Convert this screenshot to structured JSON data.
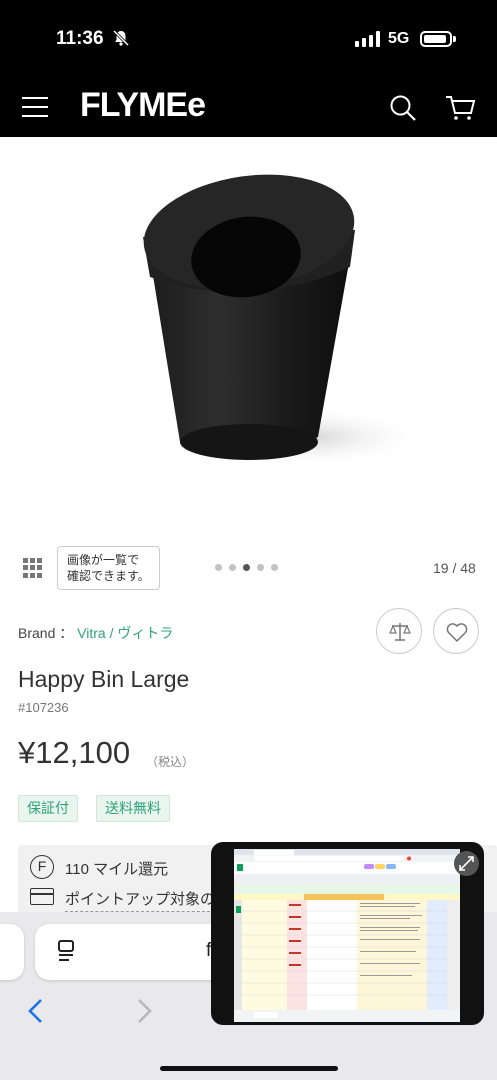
{
  "status_bar": {
    "time": "11:36",
    "network": "5G"
  },
  "header": {
    "logo": "FLYMEe"
  },
  "gallery": {
    "tooltip_line1": "画像が一覧で",
    "tooltip_line2": "確認できます。",
    "counter": "19 / 48",
    "dots_total": 5,
    "active_dot": 3
  },
  "product": {
    "brand_label": "Brand ：",
    "brand_name": "Vitra / ヴィトラ",
    "name": "Happy Bin Large",
    "number": "#107236",
    "price": "¥12,100",
    "tax_note": "（税込）",
    "tags": [
      "保証付",
      "送料無料"
    ],
    "mile_text": "110 マイル還元",
    "point_text": "ポイントアップ対象の",
    "f_symbol": "F"
  },
  "browser": {
    "url_fragment": "f"
  },
  "colors": {
    "accent_green": "#2fa37a",
    "header_bg": "#000000"
  }
}
